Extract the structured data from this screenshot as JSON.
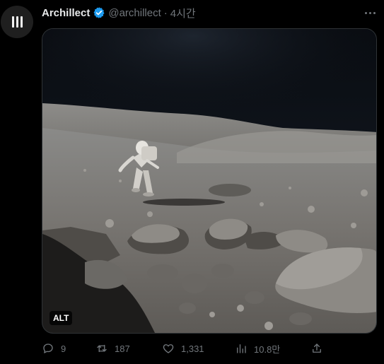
{
  "author": {
    "name": "Archillect",
    "handle": "@archillect",
    "separator": "·",
    "time": "4시간",
    "verified_color": "#1d9bf0"
  },
  "media": {
    "alt_badge": "ALT",
    "icon_name": "moon-surface-photo"
  },
  "actions": {
    "reply_count": "9",
    "retweet_count": "187",
    "like_count": "1,331",
    "views_count": "10.8만"
  },
  "colors": {
    "background": "#000000",
    "text": "#e7e9ea",
    "muted": "#71767b",
    "accent": "#1d9bf0"
  }
}
